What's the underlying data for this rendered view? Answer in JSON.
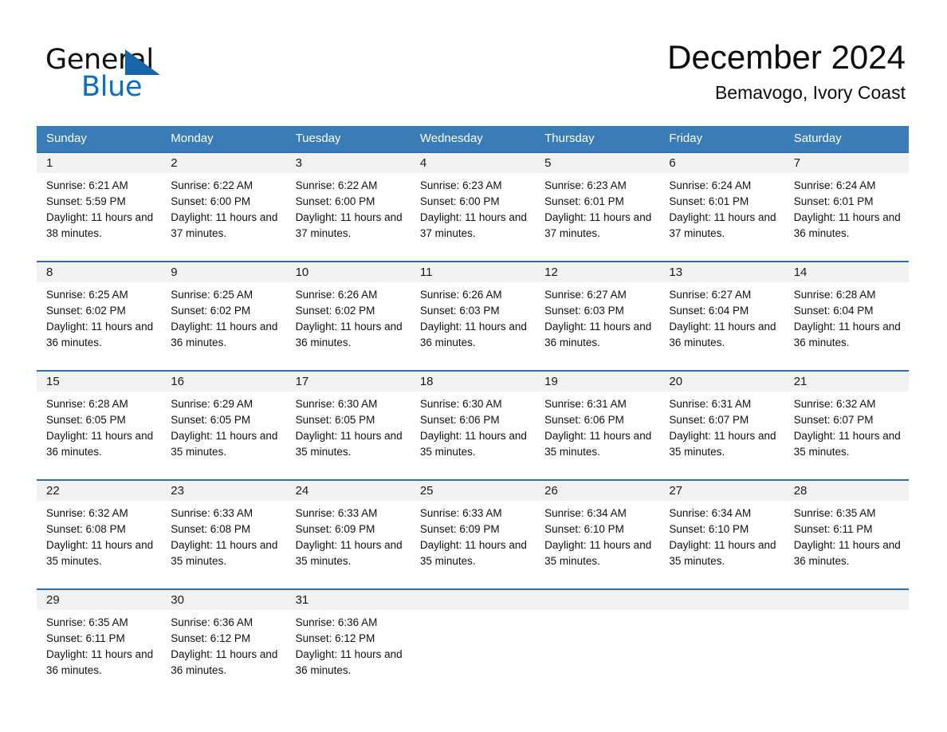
{
  "brand": {
    "word_general": "General",
    "word_blue": "Blue",
    "triangle_color": "#1565a8",
    "blue_color": "#0a6ec4"
  },
  "header": {
    "title": "December 2024",
    "subtitle": "Bemavogo, Ivory Coast"
  },
  "theme": {
    "header_row_bg": "#3a7cb8",
    "row_divider": "#2f6fae",
    "daynum_bg": "#f2f2f2"
  },
  "weekdays": [
    "Sunday",
    "Monday",
    "Tuesday",
    "Wednesday",
    "Thursday",
    "Friday",
    "Saturday"
  ],
  "weeks": [
    [
      {
        "day": "1",
        "sunrise": "Sunrise: 6:21 AM",
        "sunset": "Sunset: 5:59 PM",
        "daylight": "Daylight: 11 hours and 38 minutes."
      },
      {
        "day": "2",
        "sunrise": "Sunrise: 6:22 AM",
        "sunset": "Sunset: 6:00 PM",
        "daylight": "Daylight: 11 hours and 37 minutes."
      },
      {
        "day": "3",
        "sunrise": "Sunrise: 6:22 AM",
        "sunset": "Sunset: 6:00 PM",
        "daylight": "Daylight: 11 hours and 37 minutes."
      },
      {
        "day": "4",
        "sunrise": "Sunrise: 6:23 AM",
        "sunset": "Sunset: 6:00 PM",
        "daylight": "Daylight: 11 hours and 37 minutes."
      },
      {
        "day": "5",
        "sunrise": "Sunrise: 6:23 AM",
        "sunset": "Sunset: 6:01 PM",
        "daylight": "Daylight: 11 hours and 37 minutes."
      },
      {
        "day": "6",
        "sunrise": "Sunrise: 6:24 AM",
        "sunset": "Sunset: 6:01 PM",
        "daylight": "Daylight: 11 hours and 37 minutes."
      },
      {
        "day": "7",
        "sunrise": "Sunrise: 6:24 AM",
        "sunset": "Sunset: 6:01 PM",
        "daylight": "Daylight: 11 hours and 36 minutes."
      }
    ],
    [
      {
        "day": "8",
        "sunrise": "Sunrise: 6:25 AM",
        "sunset": "Sunset: 6:02 PM",
        "daylight": "Daylight: 11 hours and 36 minutes."
      },
      {
        "day": "9",
        "sunrise": "Sunrise: 6:25 AM",
        "sunset": "Sunset: 6:02 PM",
        "daylight": "Daylight: 11 hours and 36 minutes."
      },
      {
        "day": "10",
        "sunrise": "Sunrise: 6:26 AM",
        "sunset": "Sunset: 6:02 PM",
        "daylight": "Daylight: 11 hours and 36 minutes."
      },
      {
        "day": "11",
        "sunrise": "Sunrise: 6:26 AM",
        "sunset": "Sunset: 6:03 PM",
        "daylight": "Daylight: 11 hours and 36 minutes."
      },
      {
        "day": "12",
        "sunrise": "Sunrise: 6:27 AM",
        "sunset": "Sunset: 6:03 PM",
        "daylight": "Daylight: 11 hours and 36 minutes."
      },
      {
        "day": "13",
        "sunrise": "Sunrise: 6:27 AM",
        "sunset": "Sunset: 6:04 PM",
        "daylight": "Daylight: 11 hours and 36 minutes."
      },
      {
        "day": "14",
        "sunrise": "Sunrise: 6:28 AM",
        "sunset": "Sunset: 6:04 PM",
        "daylight": "Daylight: 11 hours and 36 minutes."
      }
    ],
    [
      {
        "day": "15",
        "sunrise": "Sunrise: 6:28 AM",
        "sunset": "Sunset: 6:05 PM",
        "daylight": "Daylight: 11 hours and 36 minutes."
      },
      {
        "day": "16",
        "sunrise": "Sunrise: 6:29 AM",
        "sunset": "Sunset: 6:05 PM",
        "daylight": "Daylight: 11 hours and 35 minutes."
      },
      {
        "day": "17",
        "sunrise": "Sunrise: 6:30 AM",
        "sunset": "Sunset: 6:05 PM",
        "daylight": "Daylight: 11 hours and 35 minutes."
      },
      {
        "day": "18",
        "sunrise": "Sunrise: 6:30 AM",
        "sunset": "Sunset: 6:06 PM",
        "daylight": "Daylight: 11 hours and 35 minutes."
      },
      {
        "day": "19",
        "sunrise": "Sunrise: 6:31 AM",
        "sunset": "Sunset: 6:06 PM",
        "daylight": "Daylight: 11 hours and 35 minutes."
      },
      {
        "day": "20",
        "sunrise": "Sunrise: 6:31 AM",
        "sunset": "Sunset: 6:07 PM",
        "daylight": "Daylight: 11 hours and 35 minutes."
      },
      {
        "day": "21",
        "sunrise": "Sunrise: 6:32 AM",
        "sunset": "Sunset: 6:07 PM",
        "daylight": "Daylight: 11 hours and 35 minutes."
      }
    ],
    [
      {
        "day": "22",
        "sunrise": "Sunrise: 6:32 AM",
        "sunset": "Sunset: 6:08 PM",
        "daylight": "Daylight: 11 hours and 35 minutes."
      },
      {
        "day": "23",
        "sunrise": "Sunrise: 6:33 AM",
        "sunset": "Sunset: 6:08 PM",
        "daylight": "Daylight: 11 hours and 35 minutes."
      },
      {
        "day": "24",
        "sunrise": "Sunrise: 6:33 AM",
        "sunset": "Sunset: 6:09 PM",
        "daylight": "Daylight: 11 hours and 35 minutes."
      },
      {
        "day": "25",
        "sunrise": "Sunrise: 6:33 AM",
        "sunset": "Sunset: 6:09 PM",
        "daylight": "Daylight: 11 hours and 35 minutes."
      },
      {
        "day": "26",
        "sunrise": "Sunrise: 6:34 AM",
        "sunset": "Sunset: 6:10 PM",
        "daylight": "Daylight: 11 hours and 35 minutes."
      },
      {
        "day": "27",
        "sunrise": "Sunrise: 6:34 AM",
        "sunset": "Sunset: 6:10 PM",
        "daylight": "Daylight: 11 hours and 35 minutes."
      },
      {
        "day": "28",
        "sunrise": "Sunrise: 6:35 AM",
        "sunset": "Sunset: 6:11 PM",
        "daylight": "Daylight: 11 hours and 36 minutes."
      }
    ],
    [
      {
        "day": "29",
        "sunrise": "Sunrise: 6:35 AM",
        "sunset": "Sunset: 6:11 PM",
        "daylight": "Daylight: 11 hours and 36 minutes."
      },
      {
        "day": "30",
        "sunrise": "Sunrise: 6:36 AM",
        "sunset": "Sunset: 6:12 PM",
        "daylight": "Daylight: 11 hours and 36 minutes."
      },
      {
        "day": "31",
        "sunrise": "Sunrise: 6:36 AM",
        "sunset": "Sunset: 6:12 PM",
        "daylight": "Daylight: 11 hours and 36 minutes."
      },
      {
        "day": "",
        "sunrise": "",
        "sunset": "",
        "daylight": ""
      },
      {
        "day": "",
        "sunrise": "",
        "sunset": "",
        "daylight": ""
      },
      {
        "day": "",
        "sunrise": "",
        "sunset": "",
        "daylight": ""
      },
      {
        "day": "",
        "sunrise": "",
        "sunset": "",
        "daylight": ""
      }
    ]
  ]
}
